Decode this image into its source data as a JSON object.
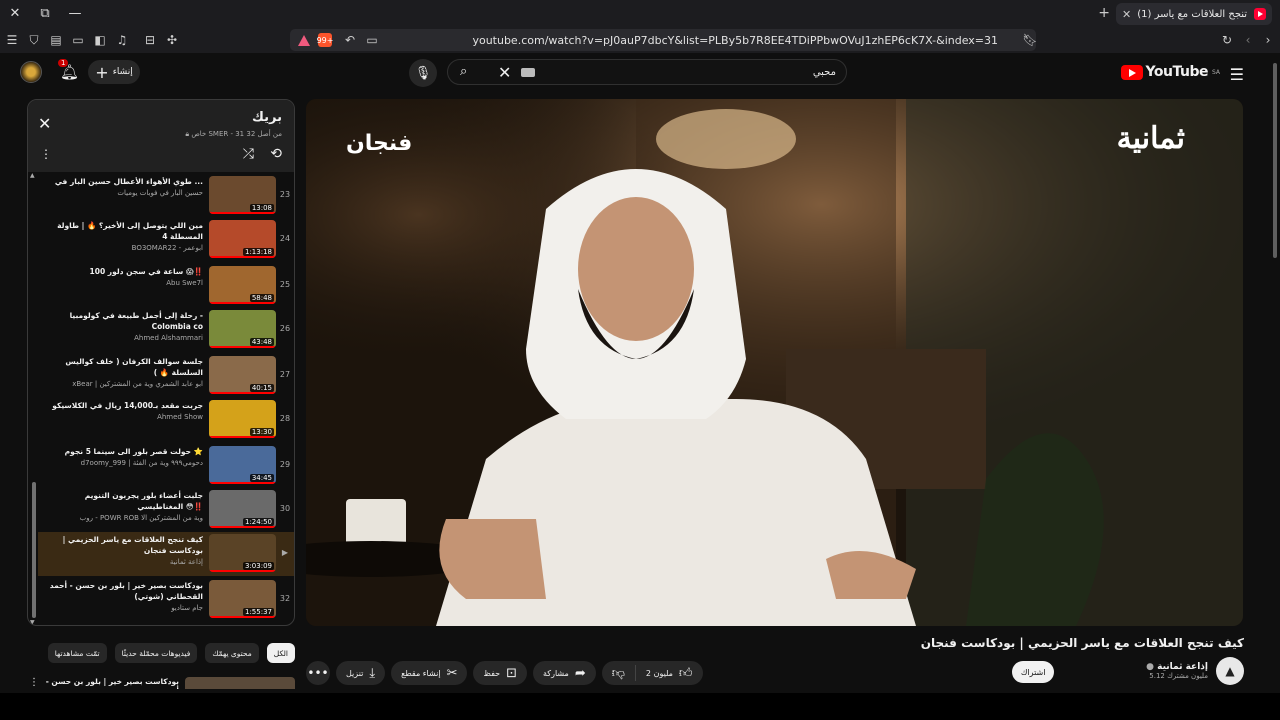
{
  "browser": {
    "tab_title": "(1) كيف تنجح العلاقات مع ياسر...",
    "url": "youtube.com/watch?v=pJ0auP7dbcY&list=PLBy5b7R8EE4TDiPPbwOVuJ1zhEP6cK7X-&index=31",
    "brave_badge": "99+"
  },
  "header": {
    "logo_text": "YouTube",
    "region": "SA",
    "search_query": "محبي",
    "create_label": "إنشاء",
    "notif_count": "1"
  },
  "video": {
    "watermark_right": "ثمانية",
    "watermark_left": "فنجان",
    "title": "كيف تنجح العلاقات مع ياسر الحزيمي | بودكاست فنجان"
  },
  "channel": {
    "name": "إذاعة ثمانية",
    "subs": "5.12 مليون مشترك",
    "subscribe_label": "اشتراك"
  },
  "actions": {
    "likes": "2 مليون",
    "share": "مشاركة",
    "save": "حفظ",
    "clip": "إنشاء مقطع",
    "download": "تنزيل"
  },
  "playlist": {
    "title": "بريك",
    "subtitle": "خاص SMER - 31 من أصل 32",
    "items": [
      {
        "idx": "23",
        "title": "طوي الأهواء الأعطال حسين البار في ...",
        "channel": "حسين البار في فوبات يوميات",
        "dur": "13:08",
        "color": "#6b4a2e"
      },
      {
        "idx": "24",
        "title": "مين اللي يتوصل إلى الأخير؟ 🔥 | طاولة المسطلة 4",
        "channel": "BO3OMAR22 - ابوعمر",
        "dur": "1:13:18",
        "color": "#b54a2a"
      },
      {
        "idx": "25",
        "title": "100 ساعة في سجن دلور 😱‼️",
        "channel": "Abu Swe7l",
        "dur": "58:48",
        "color": "#a0672f"
      },
      {
        "idx": "26",
        "title": "رحلة إلى أجمل طبيعة في كولومبيا - Colombia co",
        "channel": "Ahmed Alshammari",
        "dur": "43:48",
        "color": "#7a8a3a"
      },
      {
        "idx": "27",
        "title": "جلسة سوالف الكرفان ( خلف كواليس السلسلة 🔥 )",
        "channel": "xBear | ابو عابد الشمري وية من المشتركين",
        "dur": "40:15",
        "color": "#8a6a4a"
      },
      {
        "idx": "28",
        "title": "جربت مقعد بـ14,000 ريال في الكلاسيكو",
        "channel": "Ahmed Show",
        "dur": "13:30",
        "color": "#d4a21a"
      },
      {
        "idx": "29",
        "title": "حولت قصر بلور الى سينما 5 نجوم ⭐",
        "channel": "d7oomy_999 | دحومي٩٩٩ وية من الفئة",
        "dur": "34:45",
        "color": "#4a6a9a"
      },
      {
        "idx": "30",
        "title": "جلبت أعضاء بلور يجربون التنويم المغناطيسي 😳‼️",
        "channel": "روب - POWR ROB وية من المشتركين الا",
        "dur": "1:24:50",
        "color": "#6a6a6a"
      },
      {
        "idx": "",
        "title": "كيف تنجح العلاقات مع ياسر الحزيمي | بودكاست فنجان",
        "channel": "إذاعة ثمانية",
        "dur": "3:03:09",
        "color": "#5a4326"
      },
      {
        "idx": "32",
        "title": "بودكاست بصير خير | بلور بن حسن - أحمد القحطاني (شوتي)",
        "channel": "جام ستاديو",
        "dur": "1:55:37",
        "color": "#7a5a3a"
      }
    ]
  },
  "chips": [
    "الكل",
    "محتوى يهمّك",
    "فيديوهات محمّلة حديثًا",
    "تمّت مشاهدتها"
  ],
  "next_item_title": "بودكاست بصير خير | بلور بن حسن - أحمد"
}
